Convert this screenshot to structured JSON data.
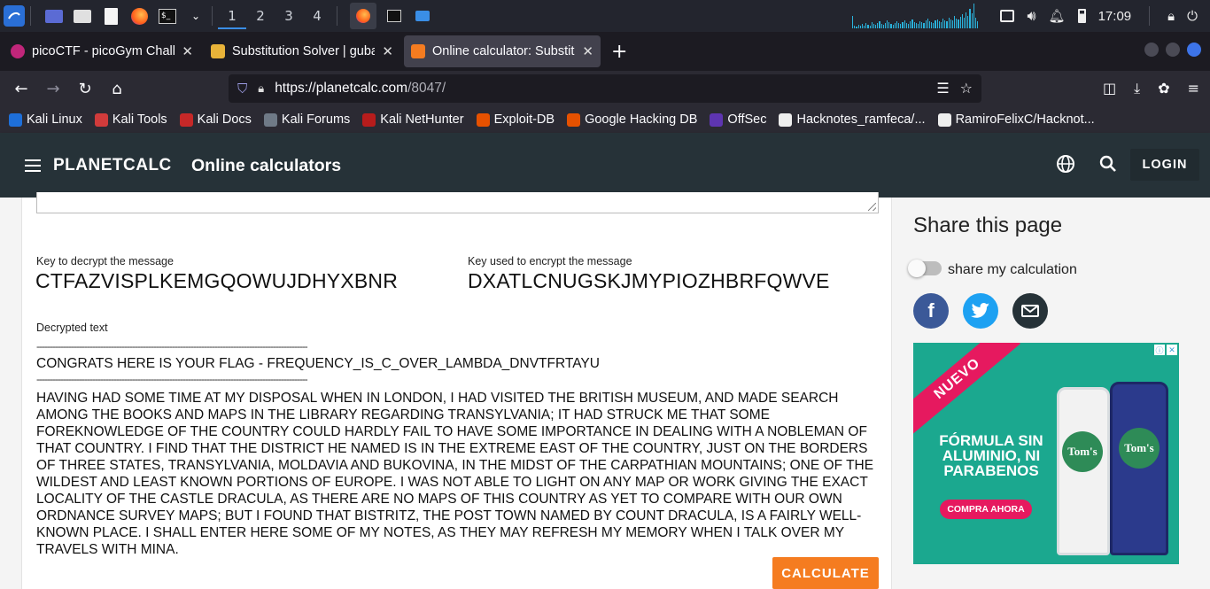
{
  "taskbar": {
    "workspaces": [
      "1",
      "2",
      "3",
      "4"
    ],
    "clock": "17:09"
  },
  "tabs": [
    {
      "title": "picoCTF - picoGym Challe",
      "favicon_color": "#c0267a"
    },
    {
      "title": "Substitution Solver | guba",
      "favicon_color": "#e8b339"
    },
    {
      "title": "Online calculator: Substitu",
      "favicon_color": "#f57c20"
    }
  ],
  "url": {
    "host": "https://planetcalc.com",
    "path": "/8047/"
  },
  "bookmarks": [
    {
      "label": "Kali Linux",
      "color": "#1e6fd9"
    },
    {
      "label": "Kali Tools",
      "color": "#d13b3b"
    },
    {
      "label": "Kali Docs",
      "color": "#c62828"
    },
    {
      "label": "Kali Forums",
      "color": "#6f7a87"
    },
    {
      "label": "Kali NetHunter",
      "color": "#b71c1c"
    },
    {
      "label": "Exploit-DB",
      "color": "#e65100"
    },
    {
      "label": "Google Hacking DB",
      "color": "#e65100"
    },
    {
      "label": "OffSec",
      "color": "#5e35b1"
    },
    {
      "label": "Hacknotes_ramfeca/...",
      "color": "#eeeeee"
    },
    {
      "label": "RamiroFelixC/Hacknot...",
      "color": "#eeeeee"
    }
  ],
  "header": {
    "brand": "PLANETCALC",
    "subtitle": "Online calculators",
    "login": "LOGIN"
  },
  "calculator": {
    "decrypt_key_label": "Key to decrypt the message",
    "decrypt_key": "CTFAZVISPLKEMGQOWUJDHYXBNR",
    "encrypt_key_label": "Key used to encrypt the message",
    "encrypt_key": "DXATLCNUGSKJMYPIOZHBRFQWVE",
    "decrypted_label": "Decrypted text",
    "divider": "------------------------------------------------------------------------------------------------------",
    "flag_line": "CONGRATS HERE IS YOUR FLAG - FREQUENCY_IS_C_OVER_LAMBDA_DNVTFRTAYU",
    "body": "HAVING HAD SOME TIME AT MY DISPOSAL WHEN IN LONDON, I HAD VISITED THE BRITISH MUSEUM, AND MADE SEARCH AMONG THE BOOKS AND MAPS IN THE LIBRARY REGARDING TRANSYLVANIA; IT HAD STRUCK ME THAT SOME FOREKNOWLEDGE OF THE COUNTRY COULD HARDLY FAIL TO HAVE SOME IMPORTANCE IN DEALING WITH A NOBLEMAN OF THAT COUNTRY. I FIND THAT THE DISTRICT HE NAMED IS IN THE EXTREME EAST OF THE COUNTRY, JUST ON THE BORDERS OF THREE STATES, TRANSYLVANIA, MOLDAVIA AND BUKOVINA, IN THE MIDST OF THE CARPATHIAN MOUNTAINS; ONE OF THE WILDEST AND LEAST KNOWN PORTIONS OF EUROPE. I WAS NOT ABLE TO LIGHT ON ANY MAP OR WORK GIVING THE EXACT LOCALITY OF THE CASTLE DRACULA, AS THERE ARE NO MAPS OF THIS COUNTRY AS YET TO COMPARE WITH OUR OWN ORDNANCE SURVEY MAPS; BUT I FOUND THAT BISTRITZ, THE POST TOWN NAMED BY COUNT DRACULA, IS A FAIRLY WELL-KNOWN PLACE. I SHALL ENTER HERE SOME OF MY NOTES, AS THEY MAY REFRESH MY MEMORY WHEN I TALK OVER MY TRAVELS WITH MINA.",
    "calculate": "CALCULATE"
  },
  "share": {
    "title": "Share this page",
    "toggle_label": "share my calculation"
  },
  "ad": {
    "ribbon": "NUEVO",
    "headline": "FÓRMULA SIN ALUMINIO, NI PARABENOS",
    "cta": "COMPRA AHORA",
    "brand": "Tom's"
  }
}
